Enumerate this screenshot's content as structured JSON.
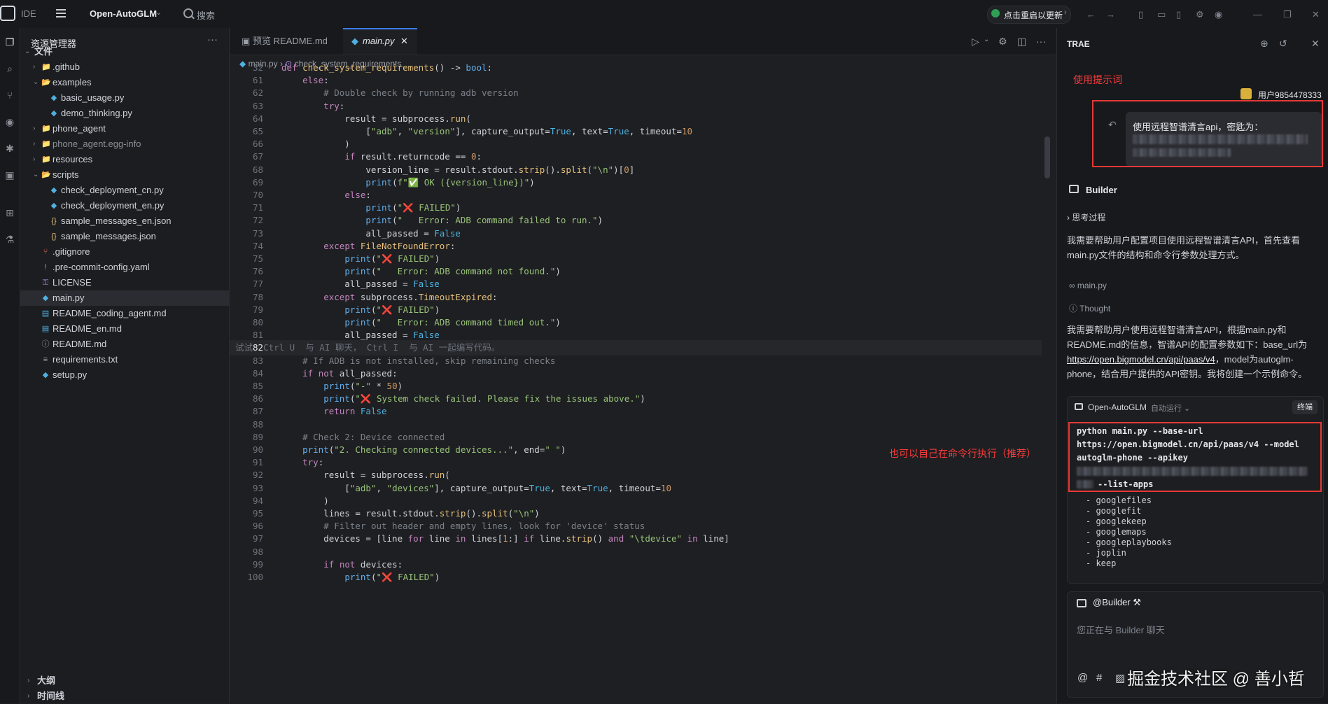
{
  "titlebar": {
    "ide_label": "IDE",
    "project_name": "Open-AutoGLM",
    "search_label": "搜索",
    "update_label": "点击重启以更新"
  },
  "explorer": {
    "title": "资源管理器",
    "sections": {
      "outline": "大纲",
      "timeline": "时间线"
    },
    "tree": [
      {
        "label": "文件",
        "type": "root"
      },
      {
        "label": ".github",
        "type": "folder"
      },
      {
        "label": "examples",
        "type": "folder-open"
      },
      {
        "label": "basic_usage.py",
        "type": "py"
      },
      {
        "label": "demo_thinking.py",
        "type": "py"
      },
      {
        "label": "phone_agent",
        "type": "folder"
      },
      {
        "label": "phone_agent.egg-info",
        "type": "folder"
      },
      {
        "label": "resources",
        "type": "folder"
      },
      {
        "label": "scripts",
        "type": "folder-open"
      },
      {
        "label": "check_deployment_cn.py",
        "type": "py"
      },
      {
        "label": "check_deployment_en.py",
        "type": "py"
      },
      {
        "label": "sample_messages_en.json",
        "type": "json"
      },
      {
        "label": "sample_messages.json",
        "type": "json"
      },
      {
        "label": ".gitignore",
        "type": "git"
      },
      {
        "label": ".pre-commit-config.yaml",
        "type": "yaml"
      },
      {
        "label": "LICENSE",
        "type": "license"
      },
      {
        "label": "main.py",
        "type": "py"
      },
      {
        "label": "README_coding_agent.md",
        "type": "md"
      },
      {
        "label": "README_en.md",
        "type": "md"
      },
      {
        "label": "README.md",
        "type": "info"
      },
      {
        "label": "requirements.txt",
        "type": "txt"
      },
      {
        "label": "setup.py",
        "type": "py"
      }
    ]
  },
  "editor": {
    "tabs": [
      {
        "label": "预览 README.md"
      },
      {
        "label": "main.py"
      }
    ],
    "breadcrumb": {
      "file": "main.py",
      "symbol": "check_system_requirements"
    },
    "lines": [
      {
        "n": "32",
        "t": "def check_system_requirements() -> bool:"
      },
      {
        "n": "61",
        "t": "    else:"
      },
      {
        "n": "62",
        "t": "        # Double check by running adb version"
      },
      {
        "n": "63",
        "t": "        try:"
      },
      {
        "n": "64",
        "t": "            result = subprocess.run("
      },
      {
        "n": "65",
        "t": "                [\"adb\", \"version\"], capture_output=True, text=True, timeout=10"
      },
      {
        "n": "66",
        "t": "            )"
      },
      {
        "n": "67",
        "t": "            if result.returncode == 0:"
      },
      {
        "n": "68",
        "t": "                version_line = result.stdout.strip().split(\"\\n\")[0]"
      },
      {
        "n": "69",
        "t": "                print(f\"✅ OK ({version_line})\")"
      },
      {
        "n": "70",
        "t": "            else:"
      },
      {
        "n": "71",
        "t": "                print(\"❌ FAILED\")"
      },
      {
        "n": "72",
        "t": "                print(\"   Error: ADB command failed to run.\")"
      },
      {
        "n": "73",
        "t": "                all_passed = False"
      },
      {
        "n": "74",
        "t": "        except FileNotFoundError:"
      },
      {
        "n": "75",
        "t": "            print(\"❌ FAILED\")"
      },
      {
        "n": "76",
        "t": "            print(\"   Error: ADB command not found.\")"
      },
      {
        "n": "77",
        "t": "            all_passed = False"
      },
      {
        "n": "78",
        "t": "        except subprocess.TimeoutExpired:"
      },
      {
        "n": "79",
        "t": "            print(\"❌ FAILED\")"
      },
      {
        "n": "80",
        "t": "            print(\"   Error: ADB command timed out.\")"
      },
      {
        "n": "81",
        "t": "            all_passed = False"
      },
      {
        "n": "82",
        "t": "试试  Ctrl U  与 AI 聊天， Ctrl I  与 AI 一起编写代码。"
      },
      {
        "n": "83",
        "t": "    # If ADB is not installed, skip remaining checks"
      },
      {
        "n": "84",
        "t": "    if not all_passed:"
      },
      {
        "n": "85",
        "t": "        print(\"-\" * 50)"
      },
      {
        "n": "86",
        "t": "        print(\"❌ System check failed. Please fix the issues above.\")"
      },
      {
        "n": "87",
        "t": "        return False"
      },
      {
        "n": "88",
        "t": ""
      },
      {
        "n": "89",
        "t": "    # Check 2: Device connected"
      },
      {
        "n": "90",
        "t": "    print(\"2. Checking connected devices...\", end=\" \")"
      },
      {
        "n": "91",
        "t": "    try:"
      },
      {
        "n": "92",
        "t": "        result = subprocess.run("
      },
      {
        "n": "93",
        "t": "            [\"adb\", \"devices\"], capture_output=True, text=True, timeout=10"
      },
      {
        "n": "94",
        "t": "        )"
      },
      {
        "n": "95",
        "t": "        lines = result.stdout.strip().split(\"\\n\")"
      },
      {
        "n": "96",
        "t": "        # Filter out header and empty lines, look for 'device' status"
      },
      {
        "n": "97",
        "t": "        devices = [line for line in lines[1:] if line.strip() and \"\\tdevice\" in line]"
      },
      {
        "n": "98",
        "t": ""
      },
      {
        "n": "99",
        "t": "        if not devices:"
      },
      {
        "n": "100",
        "t": "            print(\"❌ FAILED\")"
      }
    ],
    "annotation": "也可以自己在命令行执行（推荐）"
  },
  "chat": {
    "brand": "TRAE",
    "tip_annotation": "使用提示词",
    "user_name": "用户9854478333",
    "user_message": "使用远程智谱清言api，密匙为：",
    "builder_label": "Builder",
    "thinking_label": "思考过程",
    "para1": "我需要帮助用户配置项目使用远程智谱清言API，首先查看main.py文件的结构和命令行参数处理方式。",
    "file_ref": "main.py",
    "thought_label": "Thought",
    "para2_a": "我需要帮助用户使用远程智谱清言API，根据main.py和README.md的信息，智谱API的配置参数如下：base_url为",
    "para2_link": "https://open.bigmodel.cn/api/paas/v4",
    "para2_b": "，model为autoglm-phone，结合用户提供的API密钥。我将创建一个示例命令。",
    "terminal": {
      "title": "Open-AutoGLM",
      "mode": "自动运行",
      "button": "终端",
      "cmd1": "python main.py --base-url",
      "cmd2": "https://open.bigmodel.cn/api/paas/v4 --model",
      "cmd3": "autoglm-phone --apikey",
      "cmd5": "--list-apps",
      "output": [
        "- googlefiles",
        "- googlefit",
        "- googlekeep",
        "- googlemaps",
        "- googleplaybooks",
        "- joplin",
        "- keep"
      ]
    },
    "input_mention": "@Builder",
    "input_placeholder": "您正在与 Builder 聊天",
    "watermark": "掘金技术社区 @ 善小哲"
  },
  "colors": {
    "accent": "#3c7cf0",
    "annotation_red": "#ff3b3b",
    "ok_green": "#2f9e55"
  }
}
